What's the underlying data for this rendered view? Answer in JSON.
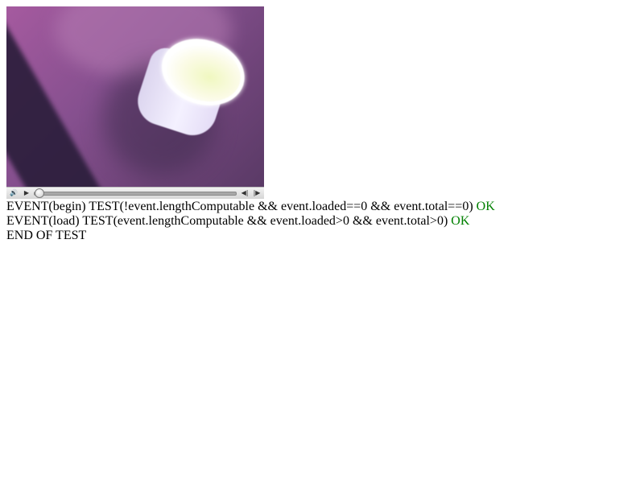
{
  "media": {
    "video_content": "paper-cup-video-frame",
    "controls": {
      "mute_icon": "🔊",
      "play_icon": "▶",
      "rewind_icon": "◀|",
      "forward_icon": "|▶",
      "progress": 0.0
    }
  },
  "log": {
    "lines": [
      {
        "text": "EVENT(begin) TEST(!event.lengthComputable && event.loaded==0 && event.total==0)",
        "status": "OK"
      },
      {
        "text": "EVENT(load) TEST(event.lengthComputable && event.loaded>0 && event.total>0)",
        "status": "OK"
      }
    ],
    "end_text": "END OF TEST"
  },
  "colors": {
    "ok": "#008000",
    "text": "#000000",
    "background": "#ffffff"
  }
}
